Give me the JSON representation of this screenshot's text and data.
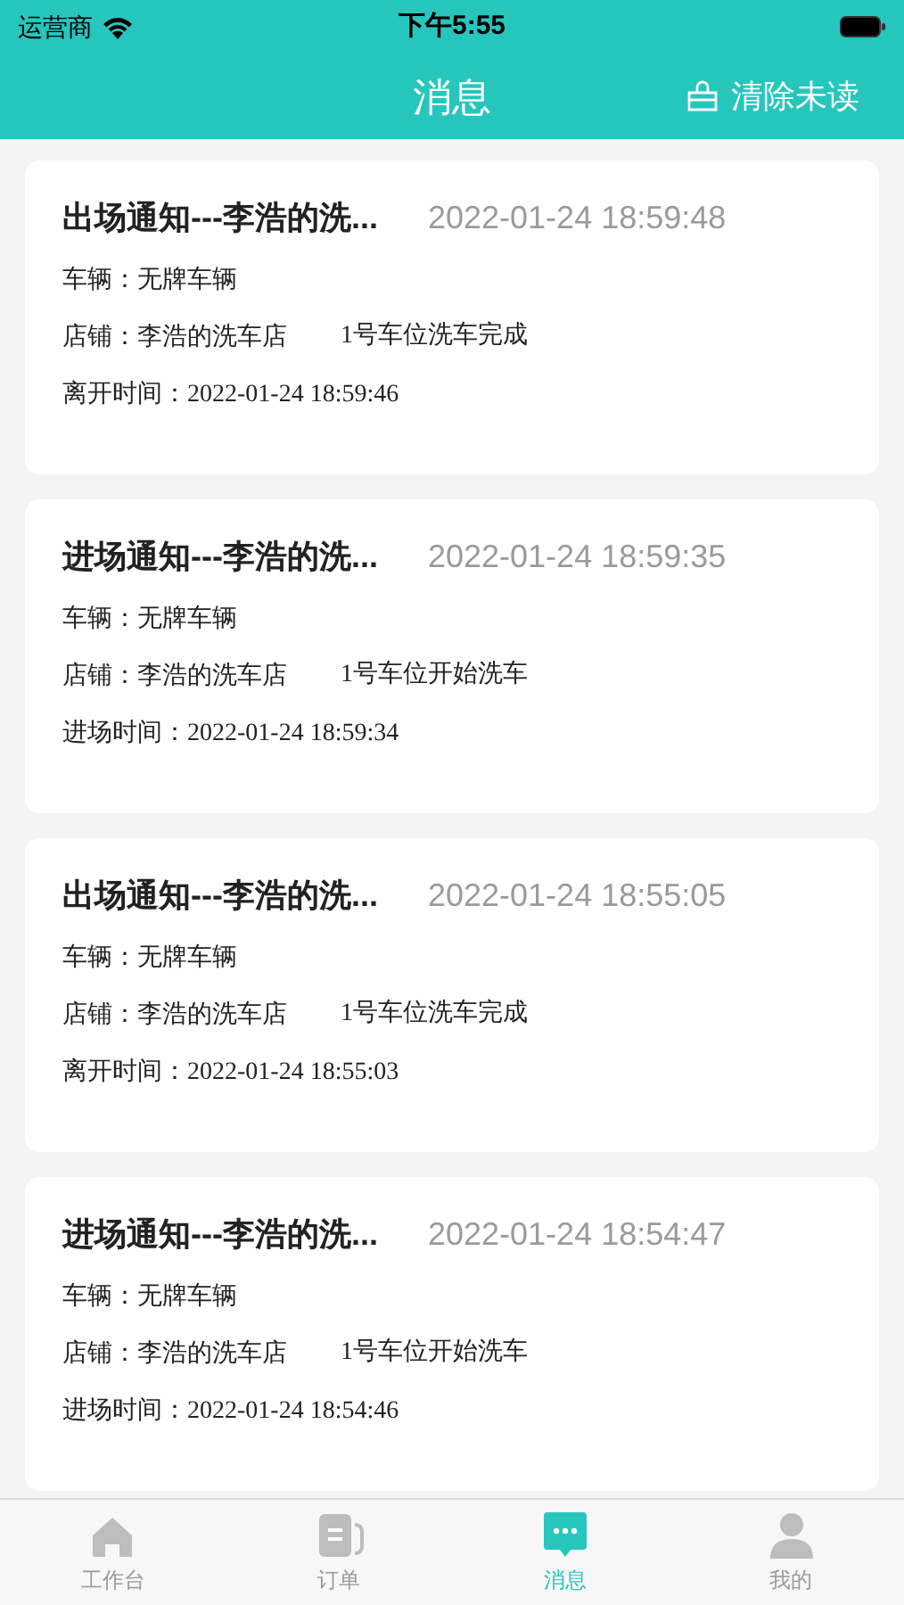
{
  "status_bar": {
    "carrier": "运营商",
    "time": "下午5:55"
  },
  "nav": {
    "title": "消息",
    "action": "清除未读"
  },
  "messages": [
    {
      "title": "出场通知---李浩的洗...",
      "time": "2022-01-24 18:59:48",
      "vehicle_label": "车辆：",
      "vehicle": "无牌车辆",
      "shop_label": "店铺：",
      "shop": "李浩的洗车店",
      "status": "1号车位洗车完成",
      "time_label": "离开时间：",
      "event_time": "2022-01-24 18:59:46"
    },
    {
      "title": "进场通知---李浩的洗...",
      "time": "2022-01-24 18:59:35",
      "vehicle_label": "车辆：",
      "vehicle": "无牌车辆",
      "shop_label": "店铺：",
      "shop": "李浩的洗车店",
      "status": "1号车位开始洗车",
      "time_label": "进场时间：",
      "event_time": "2022-01-24 18:59:34"
    },
    {
      "title": "出场通知---李浩的洗...",
      "time": "2022-01-24 18:55:05",
      "vehicle_label": "车辆：",
      "vehicle": "无牌车辆",
      "shop_label": "店铺：",
      "shop": "李浩的洗车店",
      "status": "1号车位洗车完成",
      "time_label": "离开时间：",
      "event_time": "2022-01-24 18:55:03"
    },
    {
      "title": "进场通知---李浩的洗...",
      "time": "2022-01-24 18:54:47",
      "vehicle_label": "车辆：",
      "vehicle": "无牌车辆",
      "shop_label": "店铺：",
      "shop": "李浩的洗车店",
      "status": "1号车位开始洗车",
      "time_label": "进场时间：",
      "event_time": "2022-01-24 18:54:46"
    }
  ],
  "tabs": [
    {
      "kind": "home",
      "label": "工作台",
      "selected": false
    },
    {
      "kind": "orders",
      "label": "订单",
      "selected": false
    },
    {
      "kind": "messages",
      "label": "消息",
      "selected": true
    },
    {
      "kind": "profile",
      "label": "我的",
      "selected": false
    }
  ]
}
